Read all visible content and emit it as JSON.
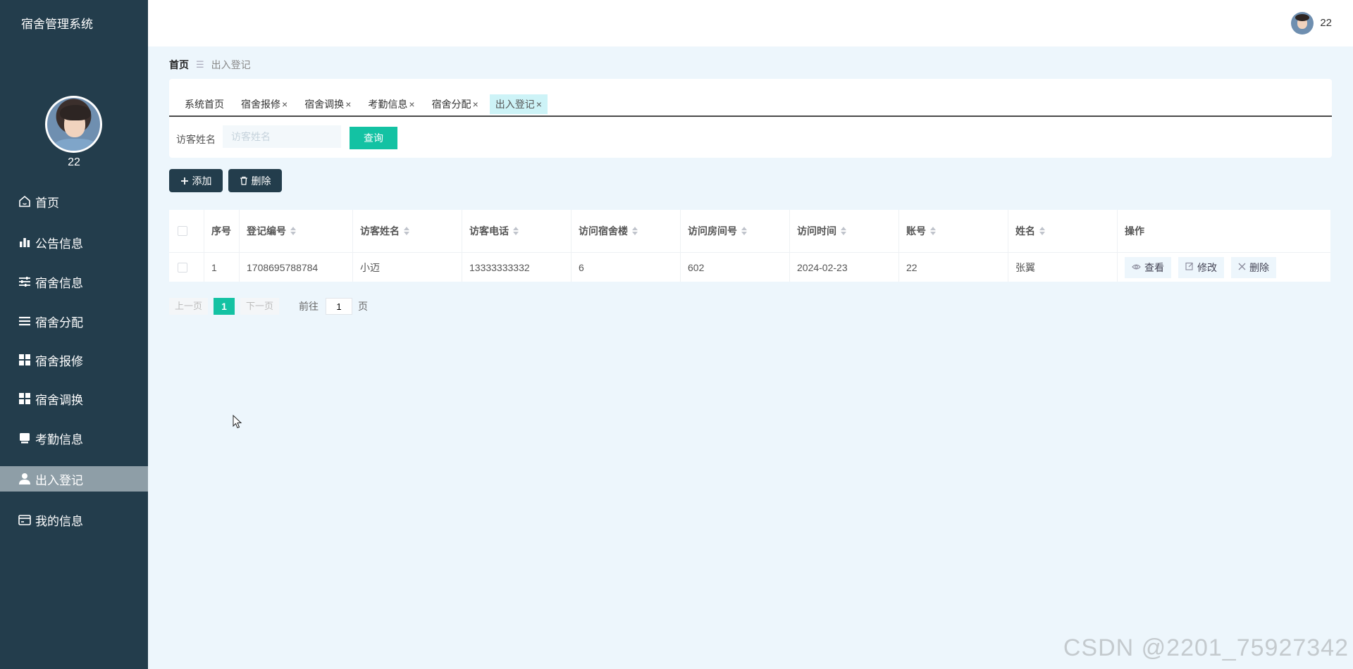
{
  "app": {
    "title": "宿舍管理系统"
  },
  "user": {
    "name": "22"
  },
  "sidebar": {
    "items": [
      {
        "label": "首页",
        "icon": "home-icon"
      },
      {
        "label": "公告信息",
        "icon": "bar-chart-icon"
      },
      {
        "label": "宿舍信息",
        "icon": "sliders-icon"
      },
      {
        "label": "宿舍分配",
        "icon": "list-icon"
      },
      {
        "label": "宿舍报修",
        "icon": "grid-icon"
      },
      {
        "label": "宿舍调换",
        "icon": "grid-icon"
      },
      {
        "label": "考勤信息",
        "icon": "inbox-icon"
      },
      {
        "label": "出入登记",
        "icon": "user-icon",
        "active": true
      },
      {
        "label": "我的信息",
        "icon": "card-icon"
      }
    ]
  },
  "breadcrumb": {
    "home": "首页",
    "separator": "☰",
    "current": "出入登记"
  },
  "tabs": [
    {
      "label": "系统首页",
      "closable": false
    },
    {
      "label": "宿舍报修",
      "closable": true
    },
    {
      "label": "宿舍调换",
      "closable": true
    },
    {
      "label": "考勤信息",
      "closable": true
    },
    {
      "label": "宿舍分配",
      "closable": true
    },
    {
      "label": "出入登记",
      "closable": true,
      "active": true
    }
  ],
  "tab_close_glyph": "×",
  "search": {
    "label": "访客姓名",
    "placeholder": "访客姓名",
    "value": "",
    "button": "查询"
  },
  "actions": {
    "add": "添加",
    "delete": "删除"
  },
  "table": {
    "columns": [
      "序号",
      "登记编号",
      "访客姓名",
      "访客电话",
      "访问宿舍楼",
      "访问房间号",
      "访问时间",
      "账号",
      "姓名",
      "操作"
    ],
    "rows": [
      {
        "index": "1",
        "reg_no": "1708695788784",
        "visitor_name": "小迈",
        "visitor_phone": "13333333332",
        "building": "6",
        "room": "602",
        "visit_time": "2024-02-23",
        "account": "22",
        "name": "张翼"
      }
    ],
    "row_actions": {
      "view": "查看",
      "edit": "修改",
      "delete": "删除"
    }
  },
  "pagination": {
    "prev": "上一页",
    "current_page": "1",
    "next": "下一页",
    "goto_label": "前往",
    "goto_value": "1",
    "page_unit": "页"
  },
  "watermark": "CSDN @2201_75927342",
  "colors": {
    "sidebar_bg": "#233d4c",
    "accent": "#13c2a3",
    "content_bg": "#edf6fc",
    "active_tab_bg": "#cdf3f7"
  }
}
